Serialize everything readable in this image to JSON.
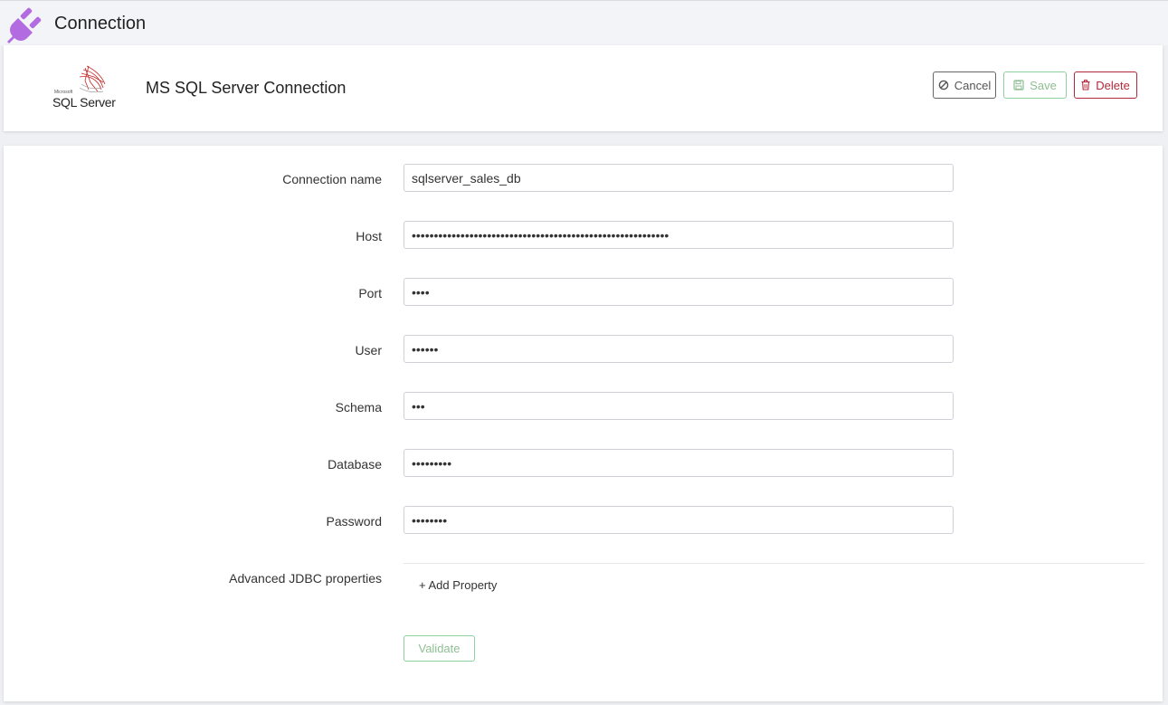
{
  "page": {
    "title": "Connection",
    "icon": "plug-icon",
    "accent": "#b26be0"
  },
  "header": {
    "logo_text": "SQL Server",
    "logo_brand": "Microsoft",
    "title": "MS SQL Server Connection",
    "buttons": {
      "cancel": {
        "label": "Cancel",
        "icon": "ban-icon"
      },
      "save": {
        "label": "Save",
        "icon": "floppy-icon"
      },
      "delete": {
        "label": "Delete",
        "icon": "trash-icon"
      }
    }
  },
  "form": {
    "fields": [
      {
        "label": "Connection name",
        "value": "sqlserver_sales_db",
        "type": "text"
      },
      {
        "label": "Host",
        "value": "••••••••••••••••••••••••••••••••••••••••••••••••••••••••••",
        "type": "text"
      },
      {
        "label": "Port",
        "value": "••••",
        "type": "text"
      },
      {
        "label": "User",
        "value": "••••••",
        "type": "text"
      },
      {
        "label": "Schema",
        "value": "•••",
        "type": "text"
      },
      {
        "label": "Database",
        "value": "•••••••••",
        "type": "text"
      },
      {
        "label": "Password",
        "value": "••••••••",
        "type": "text"
      }
    ],
    "advanced_label": "Advanced JDBC properties",
    "add_property": "+ Add Property",
    "validate_label": "Validate"
  },
  "colors": {
    "save": "#8fd19e",
    "delete": "#b0293a",
    "cancel": "#666666"
  }
}
